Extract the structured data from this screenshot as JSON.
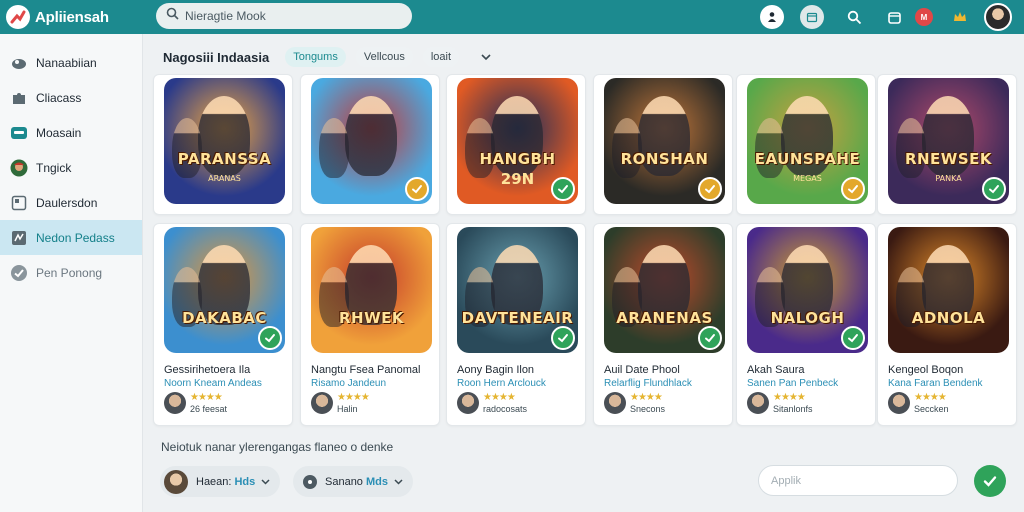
{
  "app": {
    "title": "Apliiensah"
  },
  "search": {
    "placeholder": "Nieragtie Mook"
  },
  "topbar": {
    "badge_count": "M",
    "icons": [
      "user-icon",
      "calendar-icon",
      "search-icon",
      "cart-icon",
      "notifications-icon",
      "crown-icon",
      "profile-avatar"
    ]
  },
  "sidebar": {
    "items": [
      {
        "label": "Nanaabiian",
        "icon": "cloud-icon",
        "state": "normal"
      },
      {
        "label": "Cliacass",
        "icon": "puzzle-icon",
        "state": "normal"
      },
      {
        "label": "Moasain",
        "icon": "monitor-icon",
        "state": "normal"
      },
      {
        "label": "Tngick",
        "icon": "avatar-icon",
        "state": "normal"
      },
      {
        "label": "Daulersdon",
        "icon": "square-icon",
        "state": "normal"
      },
      {
        "label": "Nedon Pedass",
        "icon": "teal-square-icon",
        "state": "active"
      },
      {
        "label": "Pen Ponong",
        "icon": "check-circle-icon",
        "state": "muted"
      }
    ]
  },
  "main": {
    "title": "Nagosiii Indaasia",
    "filters": [
      "Tongums",
      "Vellcous",
      "loait"
    ],
    "active_filter": 0,
    "row1": [
      {
        "thumb_title": "PARANSSA",
        "thumb_sub": "ARANAS",
        "check": "none",
        "theme": "#2a3a8a",
        "theme2": "#f0a640"
      },
      {
        "thumb_title": "",
        "thumb_sub": "",
        "check": "amber",
        "theme": "#4aa9e0",
        "theme2": "#c03a3a"
      },
      {
        "thumb_title": "HANGBH",
        "thumb_sub": "29N",
        "check": "green",
        "theme": "#e05a24",
        "theme2": "#1b2c5a"
      },
      {
        "thumb_title": "RONSHAN",
        "thumb_sub": "",
        "check": "amber",
        "theme": "#2b2a26",
        "theme2": "#c2773a"
      },
      {
        "thumb_title": "EAUNSPAHE",
        "thumb_sub": "MEGAS",
        "check": "amber",
        "theme": "#58a84a",
        "theme2": "#c9a040"
      },
      {
        "thumb_title": "RNEWSEK",
        "thumb_sub": "PANKA",
        "check": "green",
        "theme": "#3c2a5a",
        "theme2": "#b14a6a"
      }
    ],
    "apps": [
      {
        "name": "Gessirihetoera Ila",
        "dev": "Noorn Kneam Andeas",
        "meta": "26 feesat",
        "thumb_title": "DAKABAC",
        "thumb_sub": "",
        "check": "green",
        "theme": "#3c8fcf",
        "theme2": "#e0953a"
      },
      {
        "name": "Nangtu Fsea Panomal",
        "dev": "Risamo Jandeun",
        "meta": "Halin",
        "thumb_title": "RHWEK",
        "thumb_sub": "",
        "check": "none",
        "theme": "#f0a13a",
        "theme2": "#c43a2a"
      },
      {
        "name": "Aony Bagin Ilon",
        "dev": "Roon Hern Arclouck",
        "meta": "radocosats",
        "thumb_title": "DAVTENEAIR",
        "thumb_sub": "",
        "check": "green",
        "theme": "#2a4a5a",
        "theme2": "#6aa0b0"
      },
      {
        "name": "Auil Date Phool",
        "dev": "Relarflig Flundhlack",
        "meta": "Snecons",
        "thumb_title": "ARANENAS",
        "thumb_sub": "",
        "check": "green",
        "theme": "#2d3d2a",
        "theme2": "#c04a2a"
      },
      {
        "name": "Akah Saura",
        "dev": "Sanen Pan Penbeck",
        "meta": "Sitanlonfs",
        "thumb_title": "NALOGH",
        "thumb_sub": "",
        "check": "green",
        "theme": "#4a2a8a",
        "theme2": "#d0a030"
      },
      {
        "name": "Kengeol Boqon",
        "dev": "Kana Faran Bendenk",
        "meta": "Seccken",
        "thumb_title": "ADNOLA",
        "thumb_sub": "",
        "check": "none",
        "theme": "#3a1a12",
        "theme2": "#e08a2a"
      }
    ],
    "section_label": "Neiotuk nanar ylerengangas flaneo o denke",
    "pills": [
      {
        "prefix": "Haean:",
        "highlight": "Hds"
      },
      {
        "prefix": "Sanano",
        "highlight": "Mds"
      }
    ],
    "apply": {
      "placeholder": "Applik"
    }
  },
  "colors": {
    "brand": "#1c8a8f",
    "accent": "#2b8fb5",
    "success": "#2fa35a",
    "warning": "#e3a82b",
    "sidebar_active": "#cbe7f2"
  }
}
